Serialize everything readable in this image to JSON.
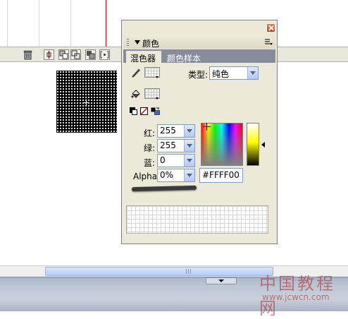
{
  "panel": {
    "title": "颜色",
    "tabs": [
      {
        "label": "混色器",
        "active": true
      },
      {
        "label": "颜色样本",
        "active": false
      }
    ],
    "type_label": "类型:",
    "type_value": "纯色",
    "channels": [
      {
        "label": "红:",
        "value": "255"
      },
      {
        "label": "绿:",
        "value": "255"
      },
      {
        "label": "蓝:",
        "value": "0"
      },
      {
        "label": "Alpha:",
        "value": "0%"
      }
    ],
    "hex_value": "#FFFF00",
    "icons": {
      "stroke": "pencil-icon",
      "fill": "paint-bucket-icon",
      "default_colors": "black-white-icon",
      "no_color": "no-color-icon",
      "swap": "swap-colors-icon",
      "close": "close-icon",
      "menu": "options-menu-icon"
    }
  },
  "watermark": {
    "main": "中国教程网",
    "url": "www.jcwcn.com"
  },
  "colors": {
    "panel_bg": "#ece9d8",
    "tab_bar": "#878c9a",
    "close_button": "#d85a30",
    "selected_color": "#FFFF00"
  }
}
